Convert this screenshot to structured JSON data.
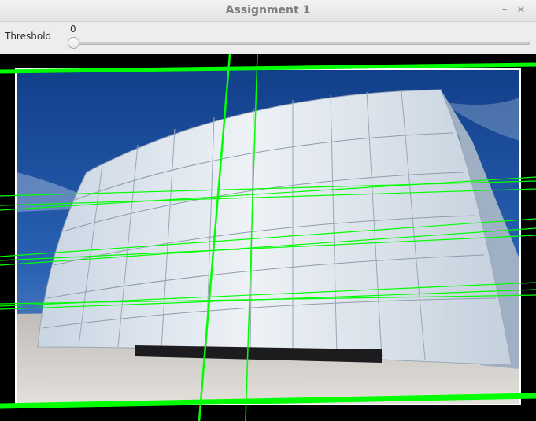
{
  "window": {
    "title": "Assignment 1",
    "minimize_symbol": "–",
    "close_symbol": "×"
  },
  "toolbar": {
    "threshold_label": "Threshold",
    "threshold_value": "0",
    "threshold_level": 0
  },
  "image": {
    "colors": {
      "line": "#00ff00",
      "sky": "#1d4f9a",
      "wall": "#dfe7ee",
      "ground": "#cfcbc6",
      "frame": "#000000"
    }
  }
}
